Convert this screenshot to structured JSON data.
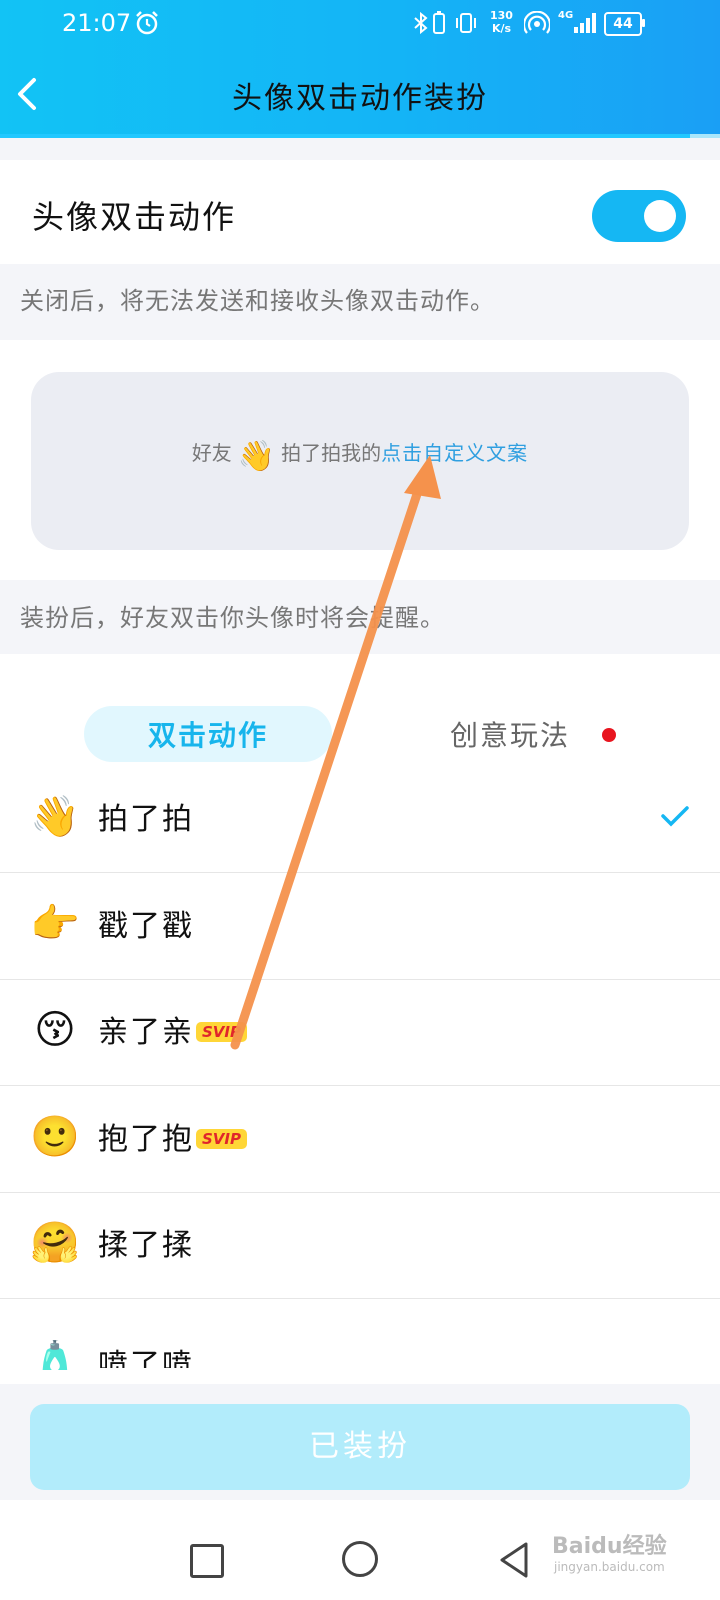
{
  "status_bar": {
    "time": "21:07",
    "network_speed_value": "130",
    "network_speed_unit": "K/s",
    "network_type": "4G",
    "battery": "44"
  },
  "header": {
    "title": "头像双击动作装扮"
  },
  "toggle": {
    "label": "头像双击动作",
    "enabled": true,
    "note": "关闭后，将无法发送和接收头像双击动作。"
  },
  "preview": {
    "prefix": "好友",
    "action": "拍了拍我的",
    "link": "点击自定义文案",
    "note": "装扮后，好友双击你头像时将会提醒。"
  },
  "tabs": [
    {
      "label": "双击动作",
      "active": true
    },
    {
      "label": "创意玩法",
      "active": false,
      "has_badge": true
    }
  ],
  "actions": [
    {
      "icon": "waving-hand-icon",
      "glyph": "👋",
      "label": "拍了拍",
      "svip": "",
      "selected": true
    },
    {
      "icon": "pointing-hand-icon",
      "glyph": "👉",
      "label": "戳了戳",
      "svip": "",
      "selected": false
    },
    {
      "icon": "kissing-face-icon",
      "glyph": "😚",
      "label": "亲了亲",
      "svip": "SVIP",
      "selected": false
    },
    {
      "icon": "hugging-person-icon",
      "glyph": "🙂",
      "label": "抱了抱",
      "svip": "SVIP",
      "selected": false
    },
    {
      "icon": "face-rub-icon",
      "glyph": "🤗",
      "label": "揉了揉",
      "svip": "",
      "selected": false
    },
    {
      "icon": "spray-bottle-icon",
      "glyph": "🧴",
      "label": "喷了喷",
      "svip": "",
      "selected": false
    }
  ],
  "equip_button": "已装扮",
  "watermark": {
    "text": "Baidu经验",
    "sub": "jingyan.baidu.com"
  },
  "colors": {
    "accent": "#15b7f3",
    "header_start": "#12c3f5",
    "header_end": "#1a9ff5",
    "link": "#2f9fe0",
    "badge": "#e8151f",
    "button_disabled": "#b2ecfb",
    "annotation_arrow": "#f5924c"
  }
}
